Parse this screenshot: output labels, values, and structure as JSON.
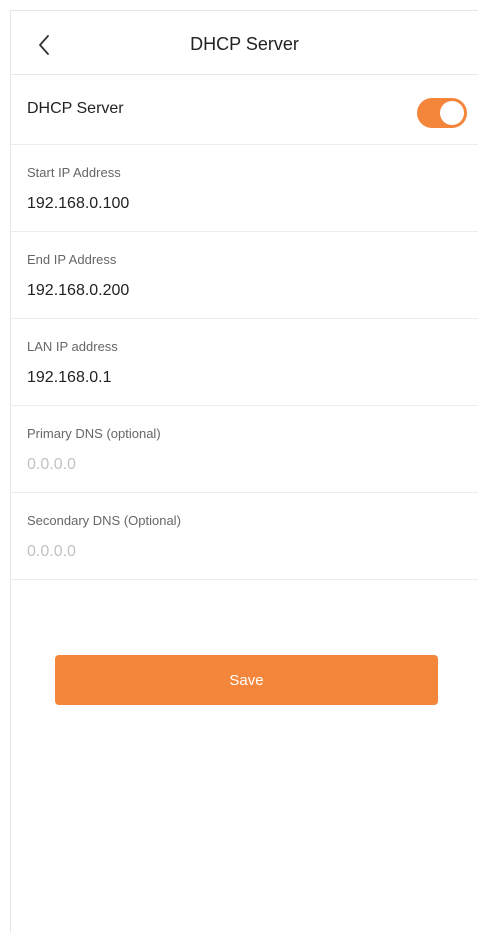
{
  "header": {
    "title": "DHCP Server",
    "back_icon": "chevron-left-icon"
  },
  "dhcp_toggle": {
    "label": "DHCP Server",
    "enabled": true,
    "color": "#f3863a"
  },
  "fields": [
    {
      "label": "Start IP Address",
      "value": "192.168.0.100",
      "placeholder": ""
    },
    {
      "label": "End IP Address",
      "value": "192.168.0.200",
      "placeholder": ""
    },
    {
      "label": "LAN IP address",
      "value": "192.168.0.1",
      "placeholder": ""
    },
    {
      "label": "Primary DNS (optional)",
      "value": "",
      "placeholder": "0.0.0.0"
    },
    {
      "label": "Secondary DNS (Optional)",
      "value": "",
      "placeholder": "0.0.0.0"
    }
  ],
  "save_button": {
    "label": "Save",
    "color": "#f3863a"
  }
}
